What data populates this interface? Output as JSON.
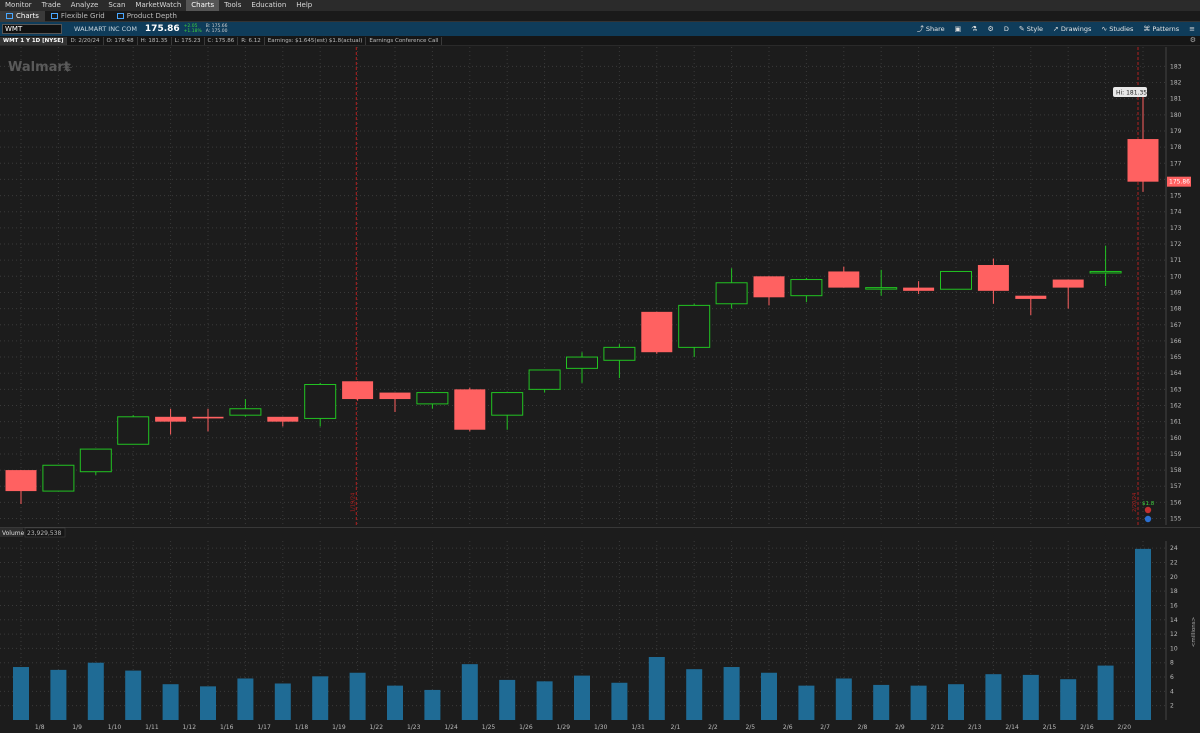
{
  "menu": [
    "Monitor",
    "Trade",
    "Analyze",
    "Scan",
    "MarketWatch",
    "Charts",
    "Tools",
    "Education",
    "Help"
  ],
  "menu_active": "Charts",
  "subtabs": [
    "Charts",
    "Flexible Grid",
    "Product Depth"
  ],
  "subtab_active": "Charts",
  "toolbar": {
    "symbol": "WMT",
    "company": "WALMART INC COM",
    "last": "175.86",
    "change_abs": "+2.05",
    "change_pct": "+1.18%",
    "bid": "B: 175.66",
    "ask": "A: 175.00",
    "buttons": {
      "share": "Share",
      "aggregation": "D",
      "style": "Style",
      "drawings": "Drawings",
      "studies": "Studies",
      "patterns": "Patterns"
    }
  },
  "infobar": {
    "title": "WMT 1 Y 1D [NYSE]",
    "date": "D: 2/20/24",
    "open": "O: 178.48",
    "high": "H: 181.35",
    "low": "L: 175.23",
    "close": "C: 175.86",
    "range": "R: 6.12",
    "earnings": "Earnings: $1.645(est) $1.8(actual)",
    "conference": "Earnings Conference Call"
  },
  "logo": "Walmart",
  "volume": {
    "label": "Volume",
    "value": "23,929,538",
    "axis_label": "<millions>"
  },
  "earnings_marker": {
    "label": "$1.8",
    "date_left": "1/19/24",
    "date_right": "2/20/24"
  },
  "colors": {
    "up": "#22c322",
    "down": "#ff6161",
    "volume": "#1f6b95",
    "background": "#1c1c1c",
    "toolbar": "#0f3c5a"
  },
  "chart_data": [
    {
      "type": "candlestick",
      "title": "WMT 1 Y 1D [NYSE]",
      "hi_label": "Hi: 181.35",
      "last_label": "175.86",
      "ylim": [
        154.6,
        184.2
      ],
      "y_ticks": [
        155,
        156,
        157,
        158,
        159,
        160,
        161,
        162,
        163,
        164,
        165,
        166,
        167,
        168,
        169,
        170,
        171,
        172,
        173,
        174,
        175,
        176,
        177,
        178,
        179,
        180,
        181,
        182,
        183
      ],
      "x_tick_labels": [
        "1/8",
        "1/9",
        "1/10",
        "1/11",
        "1/12",
        "1/16",
        "1/17",
        "1/18",
        "1/19",
        "1/22",
        "1/23",
        "1/24",
        "1/25",
        "1/26",
        "1/29",
        "1/30",
        "1/31",
        "2/1",
        "2/2",
        "2/5",
        "2/6",
        "2/7",
        "2/8",
        "2/9",
        "2/12",
        "2/13",
        "2/14",
        "2/15",
        "2/16",
        "2/20"
      ],
      "candles": [
        {
          "date": "1/5",
          "open": 158.0,
          "high": 158.0,
          "low": 155.9,
          "close": 156.7
        },
        {
          "date": "1/8",
          "open": 156.7,
          "high": 158.3,
          "low": 156.7,
          "close": 158.3
        },
        {
          "date": "1/9",
          "open": 157.9,
          "high": 159.3,
          "low": 157.7,
          "close": 159.3
        },
        {
          "date": "1/10",
          "open": 159.6,
          "high": 161.4,
          "low": 159.6,
          "close": 161.3
        },
        {
          "date": "1/11",
          "open": 161.3,
          "high": 161.8,
          "low": 160.2,
          "close": 161.0
        },
        {
          "date": "1/12",
          "open": 161.3,
          "high": 161.8,
          "low": 160.4,
          "close": 161.2
        },
        {
          "date": "1/16",
          "open": 161.4,
          "high": 162.4,
          "low": 161.3,
          "close": 161.8
        },
        {
          "date": "1/17",
          "open": 161.3,
          "high": 161.3,
          "low": 160.7,
          "close": 161.0
        },
        {
          "date": "1/18",
          "open": 161.2,
          "high": 163.4,
          "low": 160.7,
          "close": 163.3
        },
        {
          "date": "1/19",
          "open": 163.5,
          "high": 163.5,
          "low": 162.3,
          "close": 162.4
        },
        {
          "date": "1/22",
          "open": 162.8,
          "high": 162.8,
          "low": 161.6,
          "close": 162.4
        },
        {
          "date": "1/23",
          "open": 162.1,
          "high": 162.8,
          "low": 161.8,
          "close": 162.8
        },
        {
          "date": "1/24",
          "open": 163.0,
          "high": 163.1,
          "low": 160.4,
          "close": 160.5
        },
        {
          "date": "1/25",
          "open": 161.4,
          "high": 162.8,
          "low": 160.5,
          "close": 162.8
        },
        {
          "date": "1/26",
          "open": 163.0,
          "high": 164.2,
          "low": 162.8,
          "close": 164.2
        },
        {
          "date": "1/29",
          "open": 164.3,
          "high": 165.3,
          "low": 163.4,
          "close": 165.0
        },
        {
          "date": "1/30",
          "open": 164.8,
          "high": 165.8,
          "low": 163.7,
          "close": 165.6
        },
        {
          "date": "1/31",
          "open": 167.8,
          "high": 167.8,
          "low": 165.2,
          "close": 165.3
        },
        {
          "date": "2/1",
          "open": 165.6,
          "high": 168.3,
          "low": 165.0,
          "close": 168.2
        },
        {
          "date": "2/2",
          "open": 168.3,
          "high": 170.5,
          "low": 168.0,
          "close": 169.6
        },
        {
          "date": "2/5",
          "open": 170.0,
          "high": 170.0,
          "low": 168.2,
          "close": 168.7
        },
        {
          "date": "2/6",
          "open": 168.8,
          "high": 169.9,
          "low": 168.4,
          "close": 169.8
        },
        {
          "date": "2/7",
          "open": 170.3,
          "high": 170.6,
          "low": 169.3,
          "close": 169.3
        },
        {
          "date": "2/8",
          "open": 169.3,
          "high": 170.4,
          "low": 168.8,
          "close": 169.3
        },
        {
          "date": "2/9",
          "open": 169.3,
          "high": 169.7,
          "low": 168.9,
          "close": 169.1
        },
        {
          "date": "2/12",
          "open": 169.2,
          "high": 170.3,
          "low": 169.2,
          "close": 170.3
        },
        {
          "date": "2/13",
          "open": 170.7,
          "high": 171.1,
          "low": 168.3,
          "close": 169.1
        },
        {
          "date": "2/14",
          "open": 168.8,
          "high": 168.8,
          "low": 167.6,
          "close": 168.6
        },
        {
          "date": "2/15",
          "open": 169.8,
          "high": 169.8,
          "low": 168.0,
          "close": 169.3
        },
        {
          "date": "2/16",
          "open": 170.3,
          "high": 171.9,
          "low": 169.4,
          "close": 170.3
        },
        {
          "date": "2/20",
          "open": 178.5,
          "high": 181.35,
          "low": 175.23,
          "close": 175.86
        }
      ]
    },
    {
      "type": "bar",
      "title": "Volume",
      "ylabel": "<millions>",
      "ylim": [
        0,
        25
      ],
      "y_ticks": [
        2,
        4,
        6,
        8,
        10,
        12,
        14,
        16,
        18,
        20,
        22,
        24
      ],
      "categories": [
        "1/5",
        "1/8",
        "1/9",
        "1/10",
        "1/11",
        "1/12",
        "1/16",
        "1/17",
        "1/18",
        "1/19",
        "1/22",
        "1/23",
        "1/24",
        "1/25",
        "1/26",
        "1/29",
        "1/30",
        "1/31",
        "2/1",
        "2/2",
        "2/5",
        "2/6",
        "2/7",
        "2/8",
        "2/9",
        "2/12",
        "2/13",
        "2/14",
        "2/15",
        "2/16",
        "2/20"
      ],
      "values": [
        7.4,
        7.0,
        8.0,
        6.9,
        5.0,
        4.7,
        5.8,
        5.1,
        6.1,
        6.6,
        4.8,
        4.2,
        7.8,
        5.6,
        5.4,
        6.2,
        5.2,
        8.8,
        7.1,
        7.4,
        6.6,
        4.8,
        5.8,
        4.9,
        4.8,
        5.0,
        6.4,
        6.3,
        5.7,
        7.6,
        23.9
      ]
    }
  ]
}
